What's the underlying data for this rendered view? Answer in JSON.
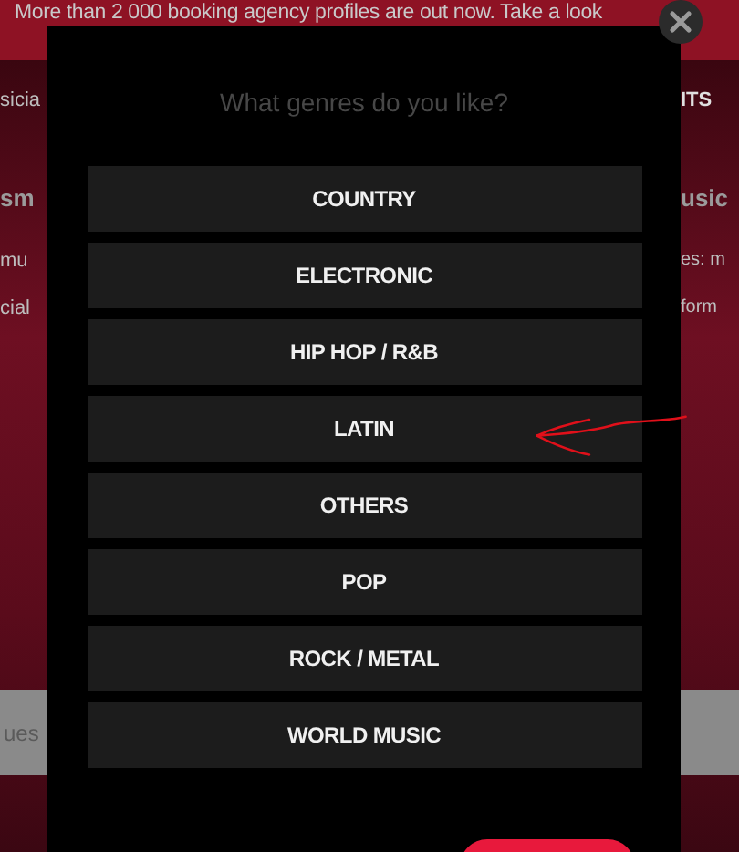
{
  "banner": {
    "text": "More than 2 000 booking agency profiles are out now. Take a look"
  },
  "background": {
    "left_fragments": [
      "sicia",
      "sm",
      "mu",
      "cial"
    ],
    "right_fragments": [
      "ITS",
      "usic",
      "es: m",
      "form"
    ],
    "band_text": "ues"
  },
  "modal": {
    "title": "What genres do you like?",
    "options": [
      {
        "label": "COUNTRY"
      },
      {
        "label": "ELECTRONIC"
      },
      {
        "label": "HIP HOP / R&B"
      },
      {
        "label": "LATIN"
      },
      {
        "label": "OTHERS"
      },
      {
        "label": "POP"
      },
      {
        "label": "ROCK / METAL"
      },
      {
        "label": "WORLD MUSIC"
      }
    ]
  }
}
